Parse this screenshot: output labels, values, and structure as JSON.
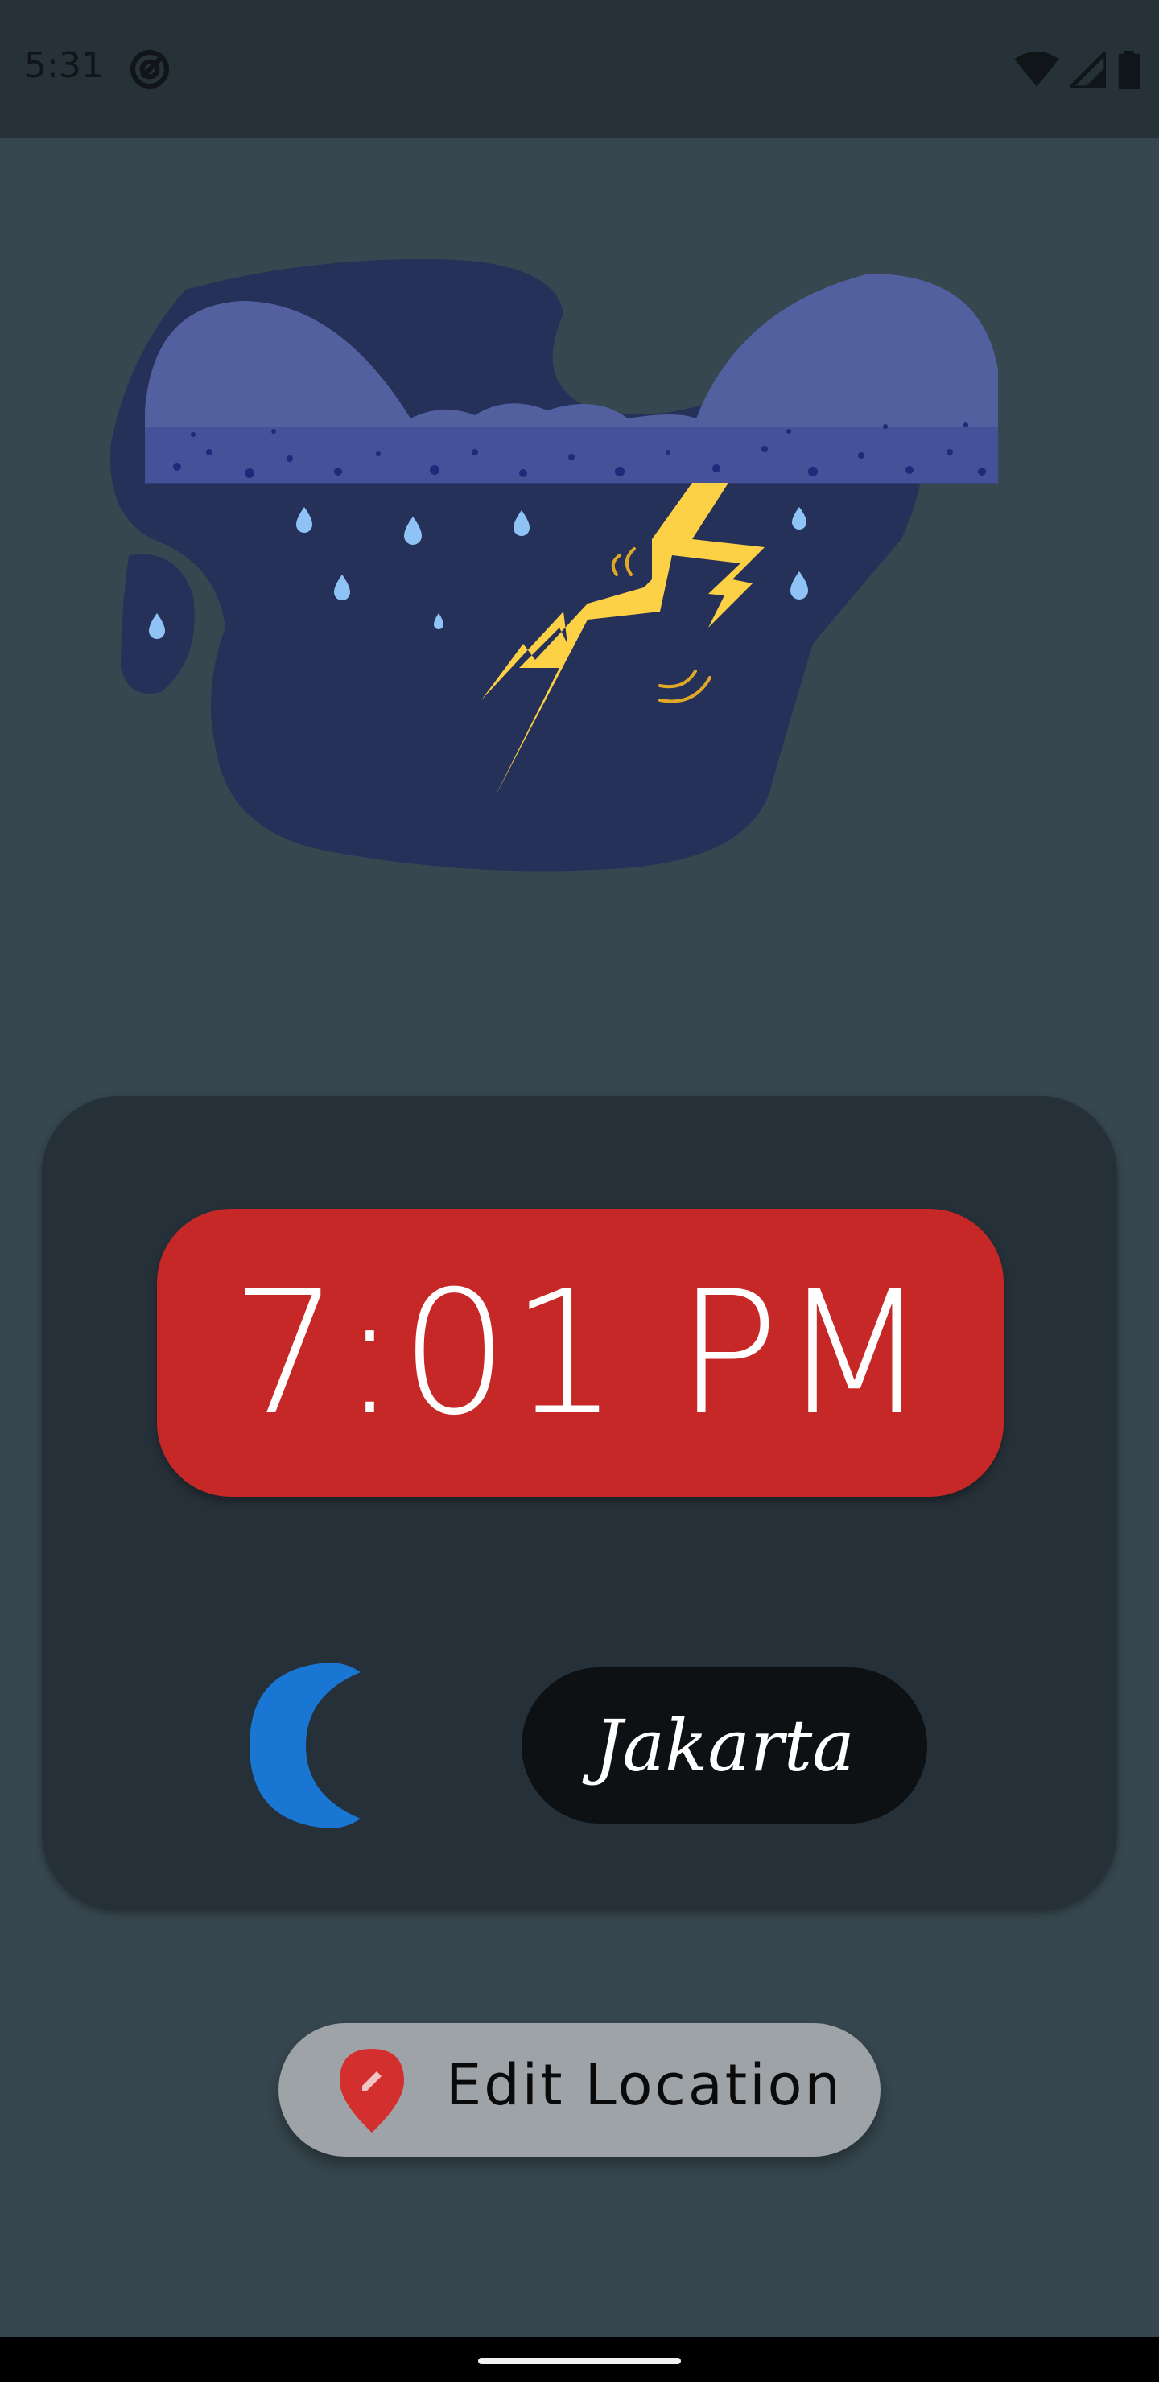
{
  "status_bar": {
    "time": "5:31",
    "icons": [
      "at-sign-icon",
      "wifi-icon",
      "signal-icon",
      "battery-icon"
    ]
  },
  "illustration": {
    "subject": "thunderstorm-cloud",
    "colors": {
      "blob": "#263159",
      "cloud": "#5360a0",
      "bolt": "#fdd146",
      "raindrop": "#8fc3f5"
    }
  },
  "clock": {
    "time": "7:01 PM",
    "background_color": "#c62828"
  },
  "daytime_indicator": {
    "icon": "moon-icon",
    "color": "#1976d2"
  },
  "location": {
    "city": "Jakarta"
  },
  "edit_button": {
    "label": "Edit Location",
    "icon": "location-pin-edit-icon",
    "icon_color": "#d32f2f"
  }
}
